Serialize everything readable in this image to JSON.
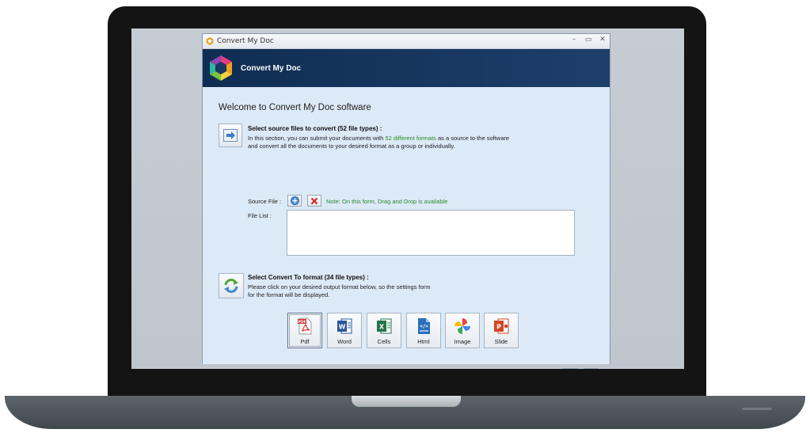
{
  "window": {
    "title": "Convert My Doc",
    "controls": {
      "minimize": "–",
      "maximize": "▭",
      "close": "✕"
    }
  },
  "banner": {
    "title": "Convert My Doc"
  },
  "welcome": "Welcome to Convert My Doc software",
  "source_section": {
    "heading": "Select source files to convert (52 file types) :",
    "line1_before": "In this section, you can submit your documents with ",
    "line1_highlight": "52 different formats",
    "line1_after": " as a source to the software",
    "line2": "and convert all the documents to your desired format as a group or individually."
  },
  "source_file": {
    "label": "Source File :",
    "note": "Note: On this form, Drag and Drop is available"
  },
  "file_list": {
    "label": "File List :"
  },
  "convert_section": {
    "heading": "Select Convert To format (34 file types) :",
    "line1": "Please click on your desired output format below, so the settings form",
    "line2": "for the format will be displayed."
  },
  "formats": [
    {
      "label": "Pdf"
    },
    {
      "label": "Word"
    },
    {
      "label": "Cells"
    },
    {
      "label": "Html"
    },
    {
      "label": "Image"
    },
    {
      "label": "Slide"
    }
  ],
  "colors": {
    "banner": "#0f2d52",
    "content_bg": "#dce9f6",
    "highlight_green": "#2b8a2b",
    "pdf": "#d32f2f",
    "word": "#2b579a",
    "cells": "#217346",
    "html": "#2a6fba",
    "slide": "#d24726"
  }
}
